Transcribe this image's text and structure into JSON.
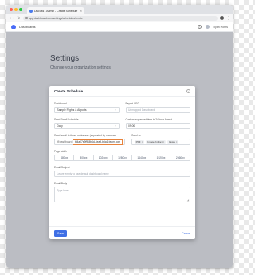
{
  "browser": {
    "tab_title": "Discuss - Admin - Create Schedule",
    "tab_close": "×",
    "url": "app.dashboard.com/settings/schedules/create",
    "colors": {
      "close": "#ff5f57",
      "minimize": "#febc2e",
      "maximize": "#28c840"
    }
  },
  "app": {
    "nav_label": "Dashboards",
    "help": "?",
    "username": "Ryan Norris"
  },
  "page": {
    "title": "Settings",
    "subtitle": "Change your organization settings"
  },
  "modal": {
    "title": "Create Schedule",
    "close": "×",
    "dashboard": {
      "label": "Dashboard",
      "value": "Sample Flights & Airports"
    },
    "report_cfg": {
      "label": "Report CFG",
      "placeholder": "Unmapped Dashboard"
    },
    "send_format": {
      "label": "Send Email Schedule",
      "value": "Daily"
    },
    "custom_time": {
      "label": "Custom expressed time in 24 hour format",
      "value": "09:00"
    },
    "email_addresses": {
      "label": "Send email to these addresses (separated by commas)",
      "prefix": "@dashboard",
      "highlight": "bi4a07e9f9-8b4d-4ea9-b5a1-team.com"
    },
    "send_as": {
      "label": "Send as",
      "pills": [
        "PDF",
        "Image (inline)",
        "Excel"
      ]
    },
    "page_width": {
      "label": "Page width",
      "options": [
        "480px",
        "800px",
        "1024px",
        "1280px",
        "1440px",
        "1920px",
        "2560px"
      ]
    },
    "email_subject": {
      "label": "Email Subject",
      "placeholder": "Leave empty to use default dashboard name"
    },
    "email_body": {
      "label": "Email Body",
      "placeholder": "Type here"
    },
    "save": "Save",
    "cancel": "Cancel"
  },
  "colors": {
    "primary": "#3f6fe5",
    "highlight_border": "#e8823a"
  }
}
